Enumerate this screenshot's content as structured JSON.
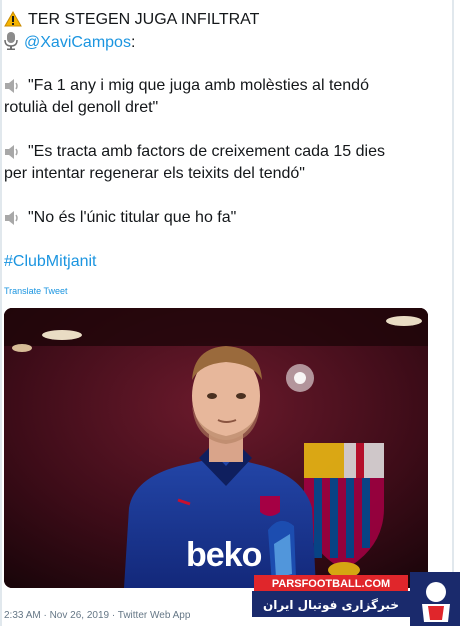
{
  "tweet": {
    "title": "TER STEGEN JUGA INFILTRAT",
    "author": "@XaviCampos",
    "author_suffix": ":",
    "quotes": [
      {
        "lines": [
          "\"Fa 1 any i mig que juga amb molèsties al tendó",
          "rotulià del genoll dret\""
        ]
      },
      {
        "lines": [
          "\"Es tracta amb factors de creixement cada 15 dies",
          "per intentar regenerar els teixits del tendó\""
        ]
      },
      {
        "lines": [
          "\"No és l'únic titular que ho fa\""
        ]
      }
    ],
    "hashtag": "#ClubMitjanit",
    "translate": "Translate Tweet",
    "timestamp": "2:33 AM · Nov 26, 2019 · Twitter Web App"
  },
  "photo": {
    "shirt_sponsor": "beko"
  },
  "watermark": {
    "site": "PARSFOOTBALL.COM",
    "tagline": "خبرگزاری فوتبال ایران"
  },
  "colors": {
    "link": "#1b95e0",
    "text": "#14171a",
    "meta": "#657786",
    "watermark_red": "#e0262b",
    "watermark_navy": "#1a2a6c"
  },
  "icons": [
    "warning-icon",
    "microphone-icon",
    "speaker-icon"
  ]
}
